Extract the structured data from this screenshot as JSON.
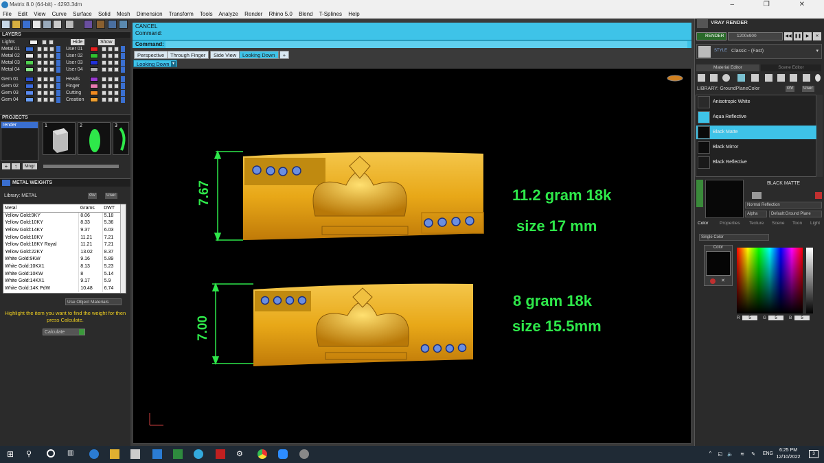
{
  "window": {
    "title": "Matrix 8.0 (64-bit) - 4293.3dm"
  },
  "menu": [
    "File",
    "Edit",
    "View",
    "Curve",
    "Surface",
    "Solid",
    "Mesh",
    "Dimension",
    "Transform",
    "Tools",
    "Analyze",
    "Render",
    "Rhino 5.0",
    "Blend",
    "T-Splines",
    "Help"
  ],
  "layers": {
    "title": "LAYERS",
    "lights": "Lights",
    "hide": "Hide",
    "show": "Show",
    "left": [
      {
        "name": "Metal 01",
        "color": "#3a6fd8"
      },
      {
        "name": "Metal 02",
        "color": "#e8e8e8"
      },
      {
        "name": "Metal 03",
        "color": "#4fd04f"
      },
      {
        "name": "Metal 04",
        "color": "#8ae88a"
      },
      {
        "name": "Gem 01",
        "color": "#2c4fd0"
      },
      {
        "name": "Gem 02",
        "color": "#3c6ce0"
      },
      {
        "name": "Gem 03",
        "color": "#5a8af0"
      },
      {
        "name": "Gem 04",
        "color": "#6aa0f8"
      }
    ],
    "right": [
      {
        "name": "User 01",
        "color": "#e82020"
      },
      {
        "name": "User 02",
        "color": "#30c030"
      },
      {
        "name": "User 03",
        "color": "#2030d8"
      },
      {
        "name": "User 04",
        "color": "#a8a8a8"
      },
      {
        "name": "Heads",
        "color": "#9a3ad0"
      },
      {
        "name": "Finger",
        "color": "#e87ab0"
      },
      {
        "name": "Cutting",
        "color": "#f08a20"
      },
      {
        "name": "Creation",
        "color": "#f0a030"
      }
    ]
  },
  "projects": {
    "title": "PROJECTS",
    "item": "render",
    "thumbs": [
      "1",
      "2",
      "3"
    ],
    "btn_mngr": "Mngr"
  },
  "metal_weights": {
    "title": "METAL WEIGHTS",
    "library_label": "Library: METAL",
    "gv": "GV",
    "user": "User",
    "headers": [
      "Metal",
      "Grams",
      "DWT"
    ],
    "rows": [
      [
        "Yellow Gold:9KY",
        "8.06",
        "5.18"
      ],
      [
        "Yellow Gold:10KY",
        "8.33",
        "5.36"
      ],
      [
        "Yellow Gold:14KY",
        "9.37",
        "6.03"
      ],
      [
        "Yellow Gold:18KY",
        "11.21",
        "7.21"
      ],
      [
        "Yellow Gold:18KY Royal",
        "11.21",
        "7.21"
      ],
      [
        "Yellow Gold:22KY",
        "13.02",
        "8.37"
      ],
      [
        "White Gold:9KW",
        "9.16",
        "5.89"
      ],
      [
        "White Gold:10KX1",
        "8.13",
        "5.23"
      ],
      [
        "White Gold:10KW",
        "8",
        "5.14"
      ],
      [
        "White Gold:14KX1",
        "9.17",
        "5.9"
      ],
      [
        "White Gold:14K PdW",
        "10.48",
        "6.74"
      ]
    ],
    "use_object_materials": "Use Object Materials",
    "hint": "Highlight the item you want to find the weight for then press Calculate.",
    "calculate": "Calculate"
  },
  "command": {
    "line1": "CANCEL",
    "line2": "Command:",
    "prompt": "Command:"
  },
  "viewport_tabs": [
    "Perspective",
    "Through Finger",
    "Side View",
    "Looking Down"
  ],
  "active_view": "Looking Down",
  "viewport_label": "Looking Down",
  "annotations": {
    "top_height": "7.67",
    "top_weight": "11.2 gram 18k",
    "top_size": "size 17 mm",
    "bottom_height": "7.00",
    "bottom_weight": "8 gram 18k",
    "bottom_size": "size 15.5mm"
  },
  "vray": {
    "title": "VRAY RENDER",
    "render": "RENDER",
    "resolution": "1200x900",
    "style_label": "STYLE",
    "style_value": "Classic - (Fast)",
    "tabs": [
      "Material Editor",
      "Scene Editor"
    ],
    "library": "LIBRARY: GroundPlaneColor",
    "gv": "GV",
    "user": "User",
    "materials": [
      {
        "name": "Anisotropic White",
        "color": "#2a2a2a"
      },
      {
        "name": "Aqua Reflective",
        "color": "#3ec3e8"
      },
      {
        "name": "Black Matte",
        "color": "#0a0a0a"
      },
      {
        "name": "Black Mirror",
        "color": "#0e0e0e"
      },
      {
        "name": "Black Reflective",
        "color": "#1a1a1a"
      }
    ],
    "selected_material": "Black Matte",
    "preview_title": "BLACK MATTE",
    "normal_reflection": "Normal Reflection",
    "alpha": "Alpha",
    "default_ground": "Default:Ground Plane",
    "bottom_tabs": [
      "Color",
      "Properties",
      "Texture",
      "Scene",
      "Toon",
      "Light"
    ],
    "color_mode": "Single Color",
    "color_label": "Color",
    "rgb": [
      "5",
      "5",
      "5"
    ],
    "rgb_labels": [
      "R",
      "G",
      "B"
    ]
  },
  "taskbar": {
    "lang": "ENG",
    "time": "6:25 PM",
    "date": "12/10/2022",
    "notif": "3"
  }
}
